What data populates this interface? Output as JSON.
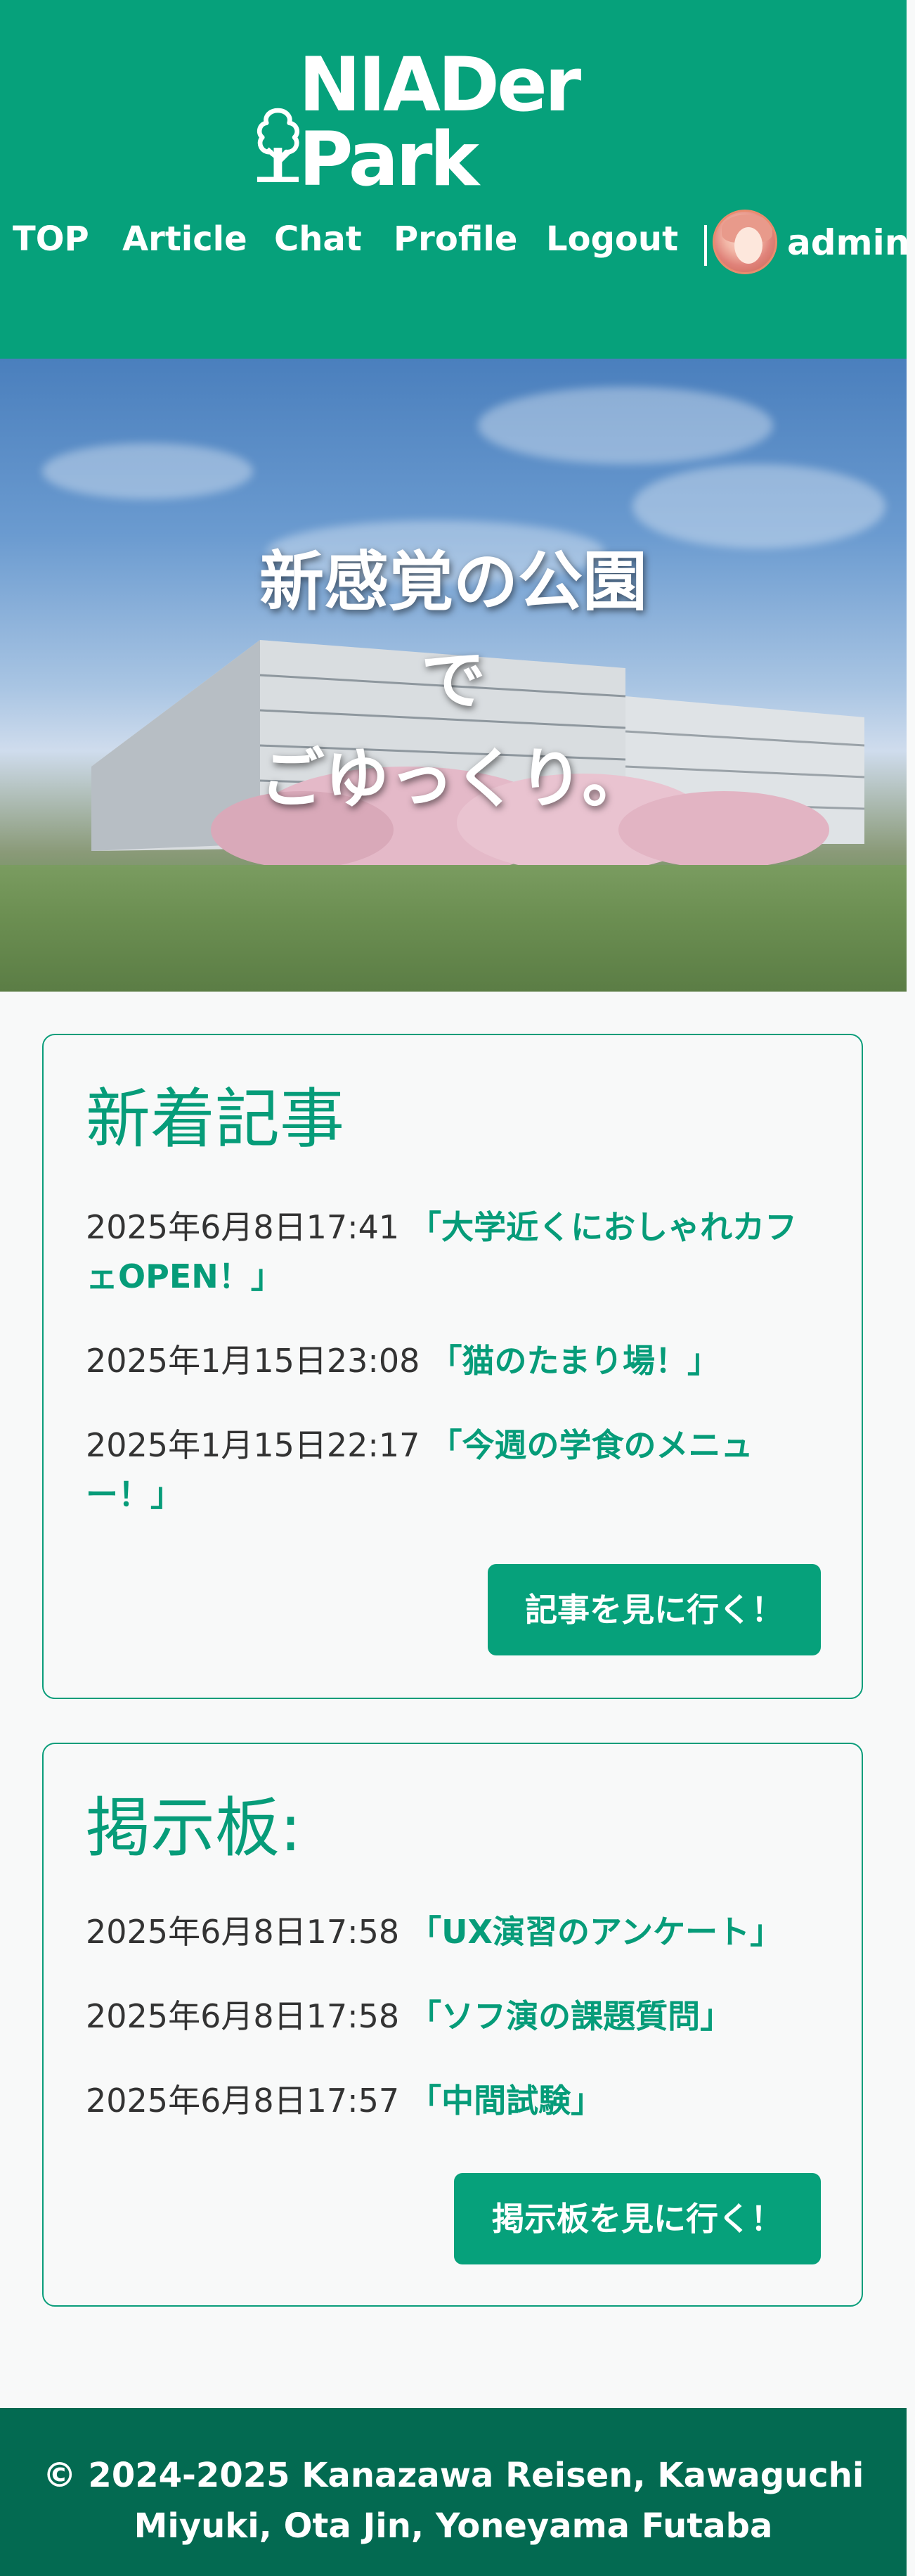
{
  "header": {
    "logo_text": "NIADer Park",
    "nav": [
      {
        "label": "TOP"
      },
      {
        "label": "Article"
      },
      {
        "label": "Chat"
      },
      {
        "label": "Profile"
      },
      {
        "label": "Logout"
      }
    ],
    "user": {
      "name": "admin",
      "avatar": "user-avatar"
    }
  },
  "hero": {
    "lines": [
      "新感覚の公園",
      "で",
      "ごゆっくり。"
    ]
  },
  "articles": {
    "title": "新着記事",
    "items": [
      {
        "date": "2025年6月8日17:41",
        "title": "「大学近くにおしゃれカフェOPEN！」"
      },
      {
        "date": "2025年1月15日23:08",
        "title": "「猫のたまり場！」"
      },
      {
        "date": "2025年1月15日22:17",
        "title": "「今週の学食のメニュー！」"
      }
    ],
    "button_label": "記事を見に行く！"
  },
  "board": {
    "title": "掲示板:",
    "items": [
      {
        "date": "2025年6月8日17:58",
        "title": "「UX演習のアンケート」"
      },
      {
        "date": "2025年6月8日17:58",
        "title": "「ソフ演の課題質問」"
      },
      {
        "date": "2025年6月8日17:57",
        "title": "「中間試験」"
      }
    ],
    "button_label": "掲示板を見に行く！"
  },
  "footer": {
    "line1": "© 2024-2025 Kanazawa Reisen, Kawaguchi",
    "line2": "Miyuki, Ota Jin, Yoneyama Futaba"
  },
  "colors": {
    "primary": "#06a17b",
    "footer": "#036a51",
    "background": "#f8f9f9",
    "text": "#333333"
  },
  "icons": [
    "tree-logo-icon",
    "user-avatar"
  ]
}
